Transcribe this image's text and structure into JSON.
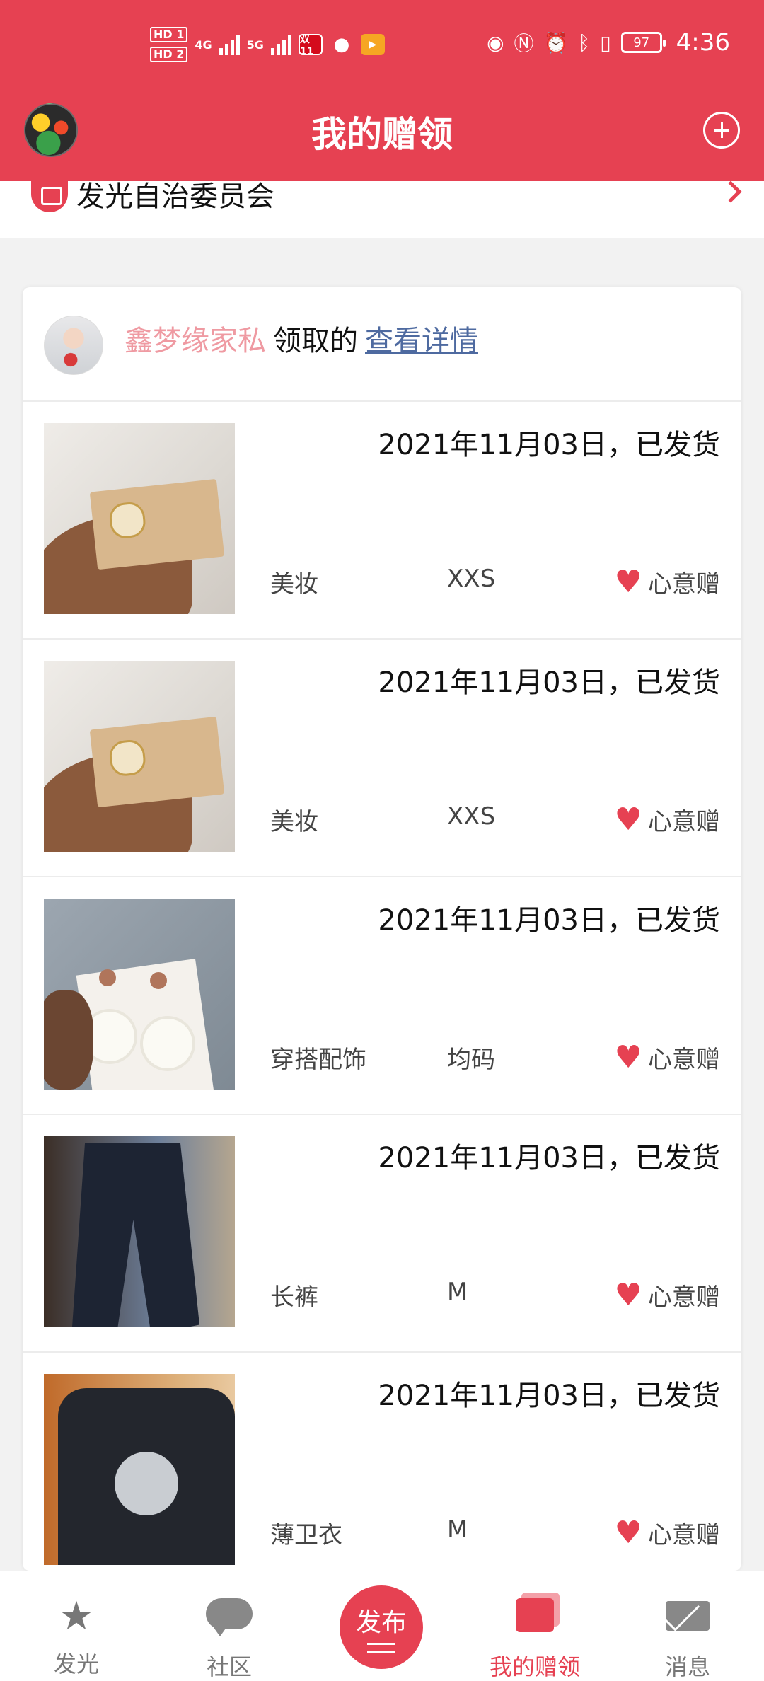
{
  "status_bar": {
    "hd1": "HD 1",
    "hd2": "HD 2",
    "net1": "4G",
    "net2": "5G",
    "sale_badge": "双11",
    "battery": "97",
    "time": "4:36"
  },
  "header": {
    "title": "我的赠领"
  },
  "org": {
    "name": "发光自治委员会"
  },
  "card": {
    "donor_name": "鑫梦缘家私",
    "mid_text": "领取的",
    "detail_link": "查看详情"
  },
  "items": [
    {
      "date": "2021年11月03日，已发货",
      "category": "美妆",
      "size": "XXS",
      "tag": "心意赠"
    },
    {
      "date": "2021年11月03日，已发货",
      "category": "美妆",
      "size": "XXS",
      "tag": "心意赠"
    },
    {
      "date": "2021年11月03日，已发货",
      "category": "穿搭配饰",
      "size": "均码",
      "tag": "心意赠"
    },
    {
      "date": "2021年11月03日，已发货",
      "category": "长裤",
      "size": "M",
      "tag": "心意赠"
    },
    {
      "date": "2021年11月03日，已发货",
      "category": "薄卫衣",
      "size": "M",
      "tag": "心意赠"
    }
  ],
  "bottom_nav": {
    "tab1": "发光",
    "tab2": "社区",
    "publish": "发布",
    "tab4": "我的赠领",
    "tab5": "消息"
  },
  "colors": {
    "brand": "#e64152",
    "donor_name": "#ef9aa2",
    "link": "#4e6aa0"
  }
}
